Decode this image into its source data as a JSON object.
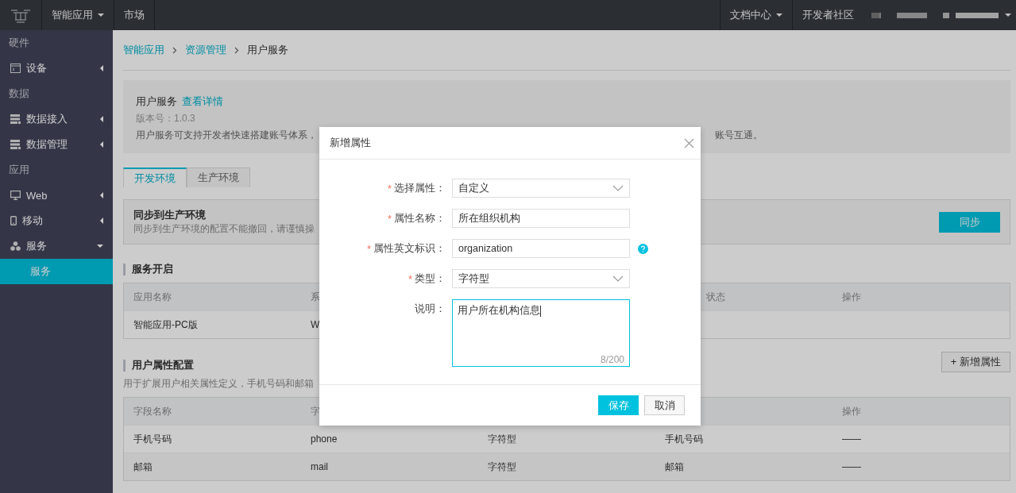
{
  "topbar": {
    "nav": [
      {
        "label": "智能应用",
        "has_menu": true
      },
      {
        "label": "市场",
        "has_menu": false
      }
    ],
    "right": [
      {
        "label": "文档中心",
        "has_menu": true
      },
      {
        "label": "开发者社区",
        "has_menu": false
      }
    ]
  },
  "sidebar": {
    "groups": [
      {
        "title": "硬件",
        "items": [
          {
            "label": "设备",
            "expanded": false
          }
        ]
      },
      {
        "title": "数据",
        "items": [
          {
            "label": "数据接入",
            "expanded": false
          },
          {
            "label": "数据管理",
            "expanded": false
          }
        ]
      },
      {
        "title": "应用",
        "items": [
          {
            "label": "Web",
            "expanded": false
          },
          {
            "label": "移动",
            "expanded": false
          },
          {
            "label": "服务",
            "expanded": true,
            "children": [
              {
                "label": "服务",
                "selected": true
              }
            ]
          }
        ]
      }
    ]
  },
  "breadcrumb": [
    {
      "label": "智能应用",
      "link": true
    },
    {
      "label": "资源管理",
      "link": true
    },
    {
      "label": "用户服务",
      "link": false
    }
  ],
  "info": {
    "title": "用户服务",
    "link": "查看详情",
    "version": "版本号：1.0.3",
    "description": "用户服务可支持开发者快速搭建账号体系，",
    "description_tail": "账号互通。"
  },
  "tabs": [
    {
      "label": "开发环境",
      "selected": true
    },
    {
      "label": "生产环境",
      "selected": false
    }
  ],
  "sync": {
    "title": "同步到生产环境",
    "note": "同步到生产环境的配置不能撤回，请谨慎操",
    "button": "同步"
  },
  "service_section": {
    "title": "服务开启",
    "table": {
      "header": {
        "column_1": "应用名称",
        "column_2": "系",
        "column_4": "状态",
        "column_5": "操作"
      },
      "rows": [
        {
          "column_1": "智能应用-PC版",
          "column_2": "W"
        }
      ]
    }
  },
  "attr_section": {
    "title": "用户属性配置",
    "description": "用于扩展用户相关属性定义，手机号码和邮箱",
    "add_button": "+ 新增属性",
    "table": {
      "header": {
        "column_1": "字段名称",
        "column_2": "字",
        "column_5": "操作"
      },
      "rows": [
        {
          "column_1": "手机号码",
          "column_2": "phone",
          "column_3": "字符型",
          "column_4": "手机号码",
          "column_5": "——"
        },
        {
          "column_1": "邮箱",
          "column_2": "mail",
          "column_3": "字符型",
          "column_4": "邮箱",
          "column_5": "——"
        }
      ]
    }
  },
  "dialog": {
    "title": "新增属性",
    "fields": [
      {
        "kind": "select",
        "label": "选择属性：",
        "required_mark": "*",
        "value": "自定义",
        "help": false,
        "focused": false
      },
      {
        "kind": "input",
        "label": "属性名称：",
        "required_mark": "*",
        "value": "所在组织机构",
        "help": false,
        "focused": false
      },
      {
        "kind": "input",
        "label": "属性英文标识：",
        "required_mark": "*",
        "value": "organization",
        "help": true,
        "focused": false
      },
      {
        "kind": "select",
        "label": "类型：",
        "required_mark": "*",
        "value": "字符型",
        "help": false,
        "focused": false
      },
      {
        "kind": "textarea",
        "label": "说明：",
        "value": "用户所在机构信息",
        "counter": "8/200",
        "help": false,
        "focused": true
      }
    ],
    "buttons": [
      {
        "label": "保存",
        "primary": true
      },
      {
        "label": "取消",
        "primary": false
      }
    ]
  }
}
